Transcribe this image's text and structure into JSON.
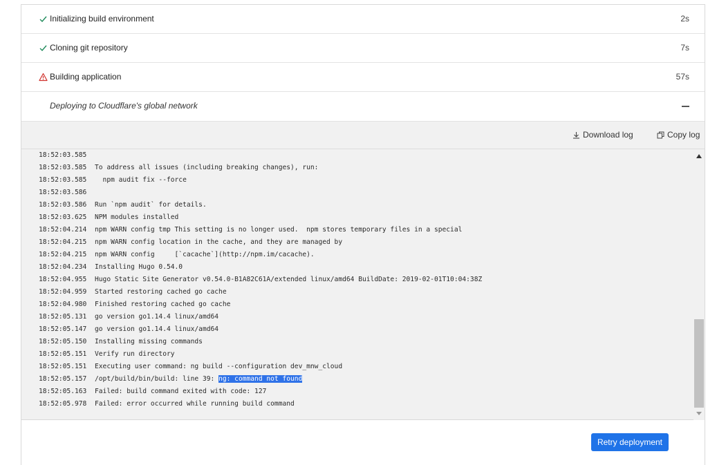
{
  "steps": [
    {
      "label": "Initializing build environment",
      "duration": "2s",
      "status": "success"
    },
    {
      "label": "Cloning git repository",
      "duration": "7s",
      "status": "success"
    },
    {
      "label": "Building application",
      "duration": "57s",
      "status": "error"
    },
    {
      "label": "Deploying to Cloudflare's global network",
      "status": "pending"
    }
  ],
  "log_toolbar": {
    "download_label": "Download log",
    "copy_label": "Copy log"
  },
  "log_lines": [
    {
      "ts": "18:52:03.585",
      "msg": ""
    },
    {
      "ts": "18:52:03.585",
      "msg": "To address all issues (including breaking changes), run:"
    },
    {
      "ts": "18:52:03.585",
      "msg": "  npm audit fix --force"
    },
    {
      "ts": "18:52:03.586",
      "msg": ""
    },
    {
      "ts": "18:52:03.586",
      "msg": "Run `npm audit` for details."
    },
    {
      "ts": "18:52:03.625",
      "msg": "NPM modules installed"
    },
    {
      "ts": "18:52:04.214",
      "msg": "npm WARN config tmp This setting is no longer used.  npm stores temporary files in a special"
    },
    {
      "ts": "18:52:04.215",
      "msg": "npm WARN config location in the cache, and they are managed by"
    },
    {
      "ts": "18:52:04.215",
      "msg": "npm WARN config     [`cacache`](http://npm.im/cacache)."
    },
    {
      "ts": "18:52:04.234",
      "msg": "Installing Hugo 0.54.0"
    },
    {
      "ts": "18:52:04.955",
      "msg": "Hugo Static Site Generator v0.54.0-B1A82C61A/extended linux/amd64 BuildDate: 2019-02-01T10:04:38Z"
    },
    {
      "ts": "18:52:04.959",
      "msg": "Started restoring cached go cache"
    },
    {
      "ts": "18:52:04.980",
      "msg": "Finished restoring cached go cache"
    },
    {
      "ts": "18:52:05.131",
      "msg": "go version go1.14.4 linux/amd64"
    },
    {
      "ts": "18:52:05.147",
      "msg": "go version go1.14.4 linux/amd64"
    },
    {
      "ts": "18:52:05.150",
      "msg": "Installing missing commands"
    },
    {
      "ts": "18:52:05.151",
      "msg": "Verify run directory"
    },
    {
      "ts": "18:52:05.151",
      "msg": "Executing user command: ng build --configuration dev_mnw_cloud"
    },
    {
      "ts": "18:52:05.157",
      "msg": "/opt/build/bin/build: line 39: ",
      "highlight": "ng: command not found"
    },
    {
      "ts": "18:52:05.163",
      "msg": "Failed: build command exited with code: 127"
    },
    {
      "ts": "18:52:05.978",
      "msg": "Failed: error occurred while running build command"
    }
  ],
  "retry_label": "Retry deployment",
  "colors": {
    "success": "#1e8a5a",
    "error": "#d0302b",
    "accent": "#1f73e8",
    "highlight": "#2f72e8"
  }
}
